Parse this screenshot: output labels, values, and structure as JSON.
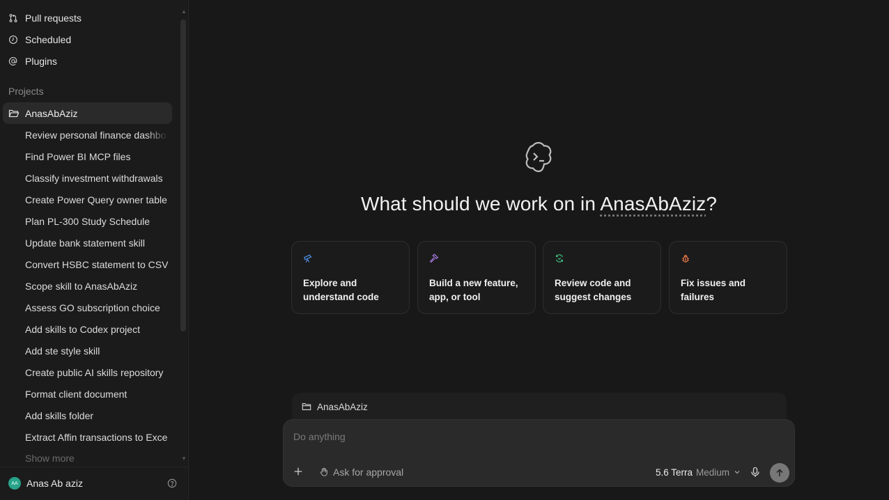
{
  "sidebar": {
    "nav": [
      {
        "label": "Pull requests",
        "icon": "pull-request-icon"
      },
      {
        "label": "Scheduled",
        "icon": "clock-icon"
      },
      {
        "label": "Plugins",
        "icon": "at-icon"
      }
    ],
    "section_label": "Projects",
    "project": "AnasAbAziz",
    "threads": [
      "Review personal finance dashboa",
      "Find Power BI MCP files",
      "Classify investment withdrawals",
      "Create Power Query owner table",
      "Plan PL-300 Study Schedule",
      "Update bank statement skill",
      "Convert HSBC statement to CSV",
      "Scope skill to AnasAbAziz",
      "Assess GO subscription choice",
      "Add skills to Codex project",
      "Add ste style skill",
      "Create public AI skills repository",
      "Format client document",
      "Add skills folder",
      "Extract Affin transactions to Excel"
    ],
    "show_more": "Show more",
    "user": {
      "name": "Anas Ab aziz",
      "initials": "AA"
    }
  },
  "main": {
    "headline_prefix": "What should we work on in ",
    "headline_project": "AnasAbAziz",
    "headline_suffix": "?",
    "cards": [
      {
        "label": "Explore and understand code",
        "icon": "telescope-icon",
        "color": "#4f8fe8"
      },
      {
        "label": "Build a new feature, app, or tool",
        "icon": "hammer-icon",
        "color": "#a87be0"
      },
      {
        "label": "Review code and suggest changes",
        "icon": "refresh-icon",
        "color": "#3fbf7f"
      },
      {
        "label": "Fix issues and failures",
        "icon": "bug-icon",
        "color": "#e8774a"
      }
    ],
    "composer": {
      "project": "AnasAbAziz",
      "placeholder": "Do anything",
      "approval": "Ask for approval",
      "model": "5.6 Terra",
      "effort": "Medium"
    }
  }
}
